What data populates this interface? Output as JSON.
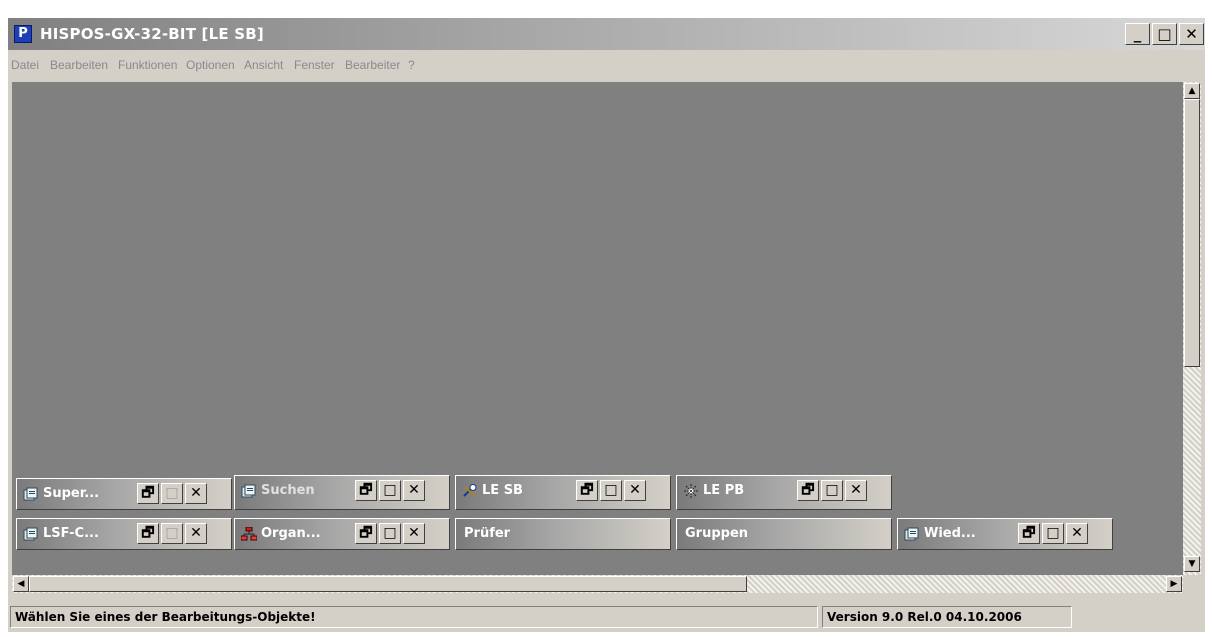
{
  "window": {
    "title": "HISPOS-GX-32-BIT [LE SB]",
    "app_icon_letter": "P",
    "controls": {
      "minimize": "_",
      "maximize": "□",
      "close": "✕"
    }
  },
  "menubar": {
    "items": [
      "Datei",
      "Bearbeiten",
      "Funktionen",
      "Optionen",
      "Ansicht",
      "Fenster",
      "Bearbeiter",
      "?"
    ]
  },
  "mdi": {
    "background": "#808080",
    "minimized_windows": [
      {
        "title": "Super...",
        "icon": "document-stack-icon",
        "has_buttons": true,
        "maximize_enabled": false
      },
      {
        "title": "Suchen",
        "icon": "document-stack-icon",
        "has_buttons": true,
        "maximize_enabled": true
      },
      {
        "title": "LE SB",
        "icon": "tools-wrench-icon",
        "has_buttons": true,
        "maximize_enabled": true
      },
      {
        "title": "LE PB",
        "icon": "sparkle-icon",
        "has_buttons": true,
        "maximize_enabled": true
      },
      {
        "title": "LSF-C...",
        "icon": "document-stack-icon",
        "has_buttons": true,
        "maximize_enabled": false
      },
      {
        "title": "Organ...",
        "icon": "organization-chart-icon",
        "has_buttons": true,
        "maximize_enabled": true
      },
      {
        "title": "Prüfer",
        "icon": "",
        "has_buttons": false,
        "maximize_enabled": false
      },
      {
        "title": "Gruppen",
        "icon": "",
        "has_buttons": false,
        "maximize_enabled": false
      },
      {
        "title": "Wied...",
        "icon": "document-stack-icon",
        "has_buttons": true,
        "maximize_enabled": true
      }
    ],
    "button_glyphs": {
      "restore": "🗗",
      "maximize": "□",
      "close": "✕"
    }
  },
  "scrollbars": {
    "up_arrow": "▲",
    "down_arrow": "▼",
    "left_arrow": "◀",
    "right_arrow": "▶"
  },
  "statusbar": {
    "message": "Wählen Sie eines der Bearbeitungs-Objekte!",
    "version": "Version 9.0 Rel.0 04.10.2006"
  }
}
